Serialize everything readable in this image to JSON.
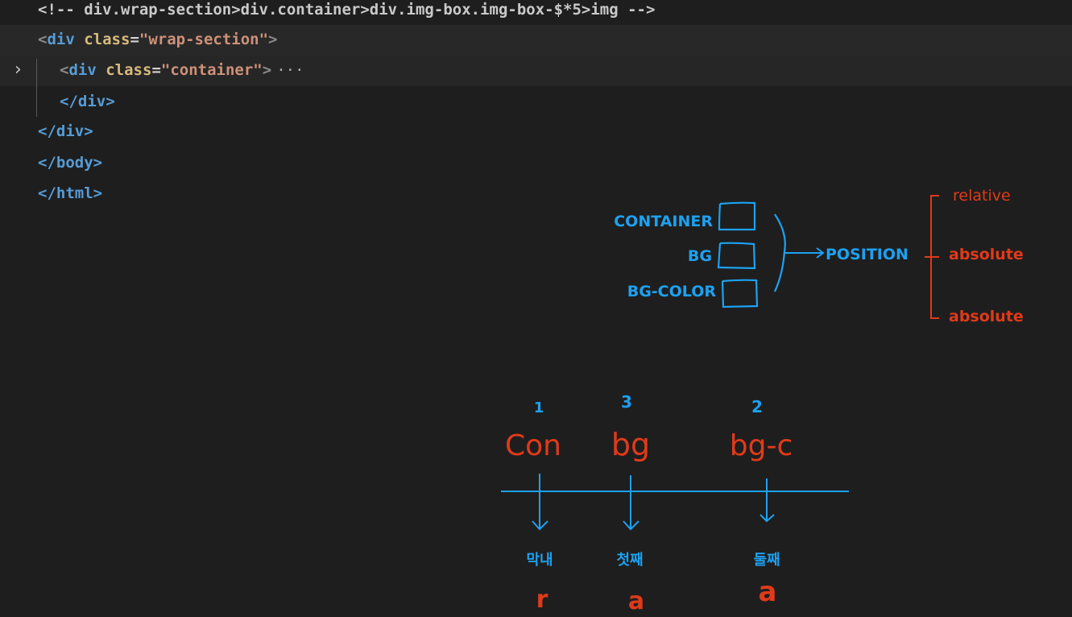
{
  "editor": {
    "lines": [
      {
        "comment": "<!-- div.wrap-section>div.container>div.img-box.img-box-$*5>img -->"
      },
      {
        "open": "<",
        "tag": "div",
        "attr": "class",
        "eq": "=",
        "value": "\"wrap-section\"",
        "close": ">"
      },
      {
        "open": "<",
        "tag": "div",
        "attr": "class",
        "eq": "=",
        "value": "\"container\"",
        "close": ">",
        "folded": "···"
      },
      {
        "close_tag": "</div>"
      },
      {
        "close_tag": "</div>"
      },
      {
        "close_tag": "</body>"
      },
      {
        "close_tag": "</html>"
      }
    ]
  },
  "annotation": {
    "upper": {
      "items": [
        "CONTAINER",
        "BG",
        "BG-COLOR"
      ],
      "target": "POSITION",
      "values": [
        "relative",
        "absolute",
        "absolute"
      ]
    },
    "lower": {
      "order": [
        "1",
        "3",
        "2"
      ],
      "names": [
        "Con",
        "bg",
        "bg-c"
      ],
      "labels": [
        "막내",
        "첫째",
        "둘째"
      ],
      "letters": [
        "r",
        "a",
        "a"
      ]
    }
  },
  "colors": {
    "blue_ink": "#1da1f2",
    "red_ink": "#e03a1a",
    "background": "#1e1e1e"
  }
}
